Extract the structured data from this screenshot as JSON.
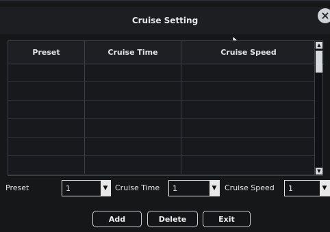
{
  "dialog": {
    "title": "Cruise Setting",
    "close_icon": "close-icon"
  },
  "table": {
    "headers": [
      "Preset",
      "Cruise Time",
      "Cruise Speed"
    ],
    "rows": [
      [],
      [],
      [],
      [],
      [],
      []
    ]
  },
  "controls": {
    "preset_label": "Preset",
    "preset_value": "1",
    "cruise_time_label": "Cruise Time",
    "cruise_time_value": "1",
    "cruise_speed_label": "Cruise Speed",
    "cruise_speed_value": "1"
  },
  "buttons": {
    "add": "Add",
    "delete": "Delete",
    "exit": "Exit"
  }
}
